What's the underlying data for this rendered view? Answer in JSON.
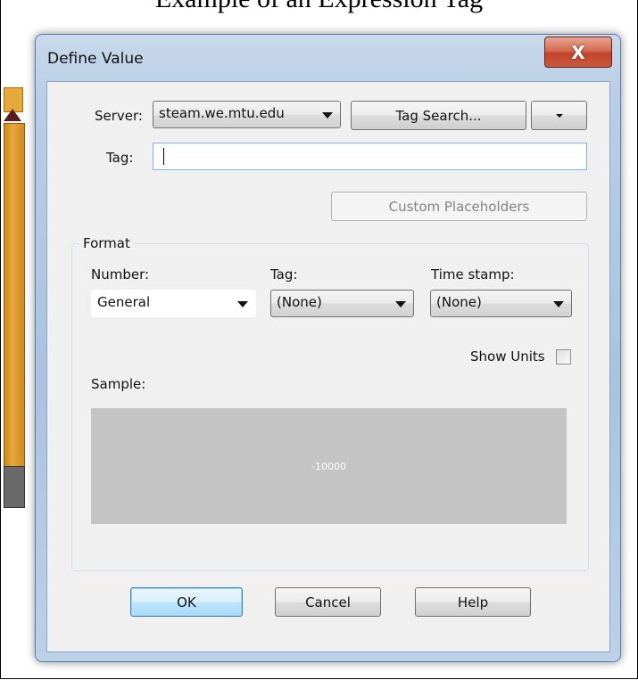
{
  "caption": "Example of an Expression Tag",
  "dialog": {
    "title": "Define Value",
    "close_label": "X",
    "server_label": "Server:",
    "server_value": "steam.we.mtu.edu",
    "tag_search_label": "Tag Search...",
    "tag_label": "Tag:",
    "tag_value": "",
    "custom_placeholders_label": "Custom Placeholders",
    "format": {
      "legend": "Format",
      "number_label": "Number:",
      "number_value": "General",
      "tag_label": "Tag:",
      "tag_value": "(None)",
      "timestamp_label": "Time stamp:",
      "timestamp_value": "(None)",
      "show_units_label": "Show Units",
      "show_units_checked": false,
      "sample_label": "Sample:",
      "sample_value": "-10000"
    },
    "buttons": {
      "ok": "OK",
      "cancel": "Cancel",
      "help": "Help"
    }
  },
  "colors": {
    "title_bar": "#b9cee6",
    "close_button": "#c75a3e",
    "sample_background": "#c4c4c4",
    "background_app": "#e8a83a"
  }
}
